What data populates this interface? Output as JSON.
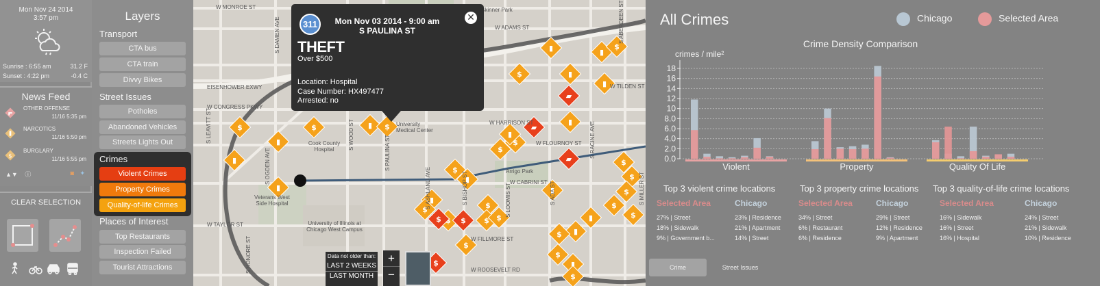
{
  "weather": {
    "date": "Mon Nov 24 2014",
    "time": "3:57 pm",
    "sunrise": "Sunrise : 6:55 am",
    "sunset": "Sunset : 4:22 pm",
    "temp_high": "31.2 F",
    "temp_low": "-0.4 C",
    "icon": "partly-cloudy-icon"
  },
  "news": {
    "title": "News Feed",
    "items": [
      {
        "type": "OTHER OFFENSE",
        "time": "11/16 5:35 pm",
        "color": "#e84c3d"
      },
      {
        "type": "NARCOTICS",
        "time": "11/16 5:50 pm",
        "color": "#f39c12"
      },
      {
        "type": "BURGLARY",
        "time": "11/16 5:55 pm",
        "color": "#f39c12"
      }
    ]
  },
  "clear_selection": "CLEAR SELECTION",
  "layers": {
    "title": "Layers",
    "transport": {
      "title": "Transport",
      "items": [
        "CTA bus",
        "CTA train",
        "Divvy Bikes"
      ]
    },
    "street": {
      "title": "Street Issues",
      "items": [
        "Potholes",
        "Abandoned Vehicles",
        "Streets Lights Out"
      ]
    },
    "crimes": {
      "title": "Crimes",
      "items": [
        {
          "label": "Violent Crimes",
          "color": "#e53e12"
        },
        {
          "label": "Property Crimes",
          "color": "#f07a0c"
        },
        {
          "label": "Quality-of-life Crimes",
          "color": "#f4a20f"
        }
      ]
    },
    "places": {
      "title": "Places of Interest",
      "items": [
        "Top Restaurants",
        "Inspection Failed Restaurants",
        "Tourist Attractions"
      ]
    }
  },
  "map": {
    "streets_h": [
      "W MONROE ST",
      "W ADAMS ST",
      "EISENHOWER EXWY",
      "W CONGRESS PKWY",
      "W HARRISON ST",
      "W FLOURNOY ST",
      "W CABRINI ST",
      "W TAYLOR ST",
      "W FILLMORE ST",
      "W ROOSEVELT RD",
      "W TILDEN ST",
      "Skinner Park",
      "Arrigo Park"
    ],
    "streets_v": [
      "S DAMEN AVE",
      "S LEAVITT ST",
      "S WOOD ST",
      "S PAULINA ST",
      "S ASHLAND AVE",
      "S LOOMIS ST",
      "S ADA ST",
      "S RACINE AVE",
      "S MILLER ST",
      "S ABERDEEN ST",
      "S HONORE ST",
      "S OGDEN AVE",
      "S BISHOP ST"
    ],
    "places": [
      "Cook County Hospital",
      "Veterans West Side Hospital",
      "University of Illinois at Chicago West Campus",
      "University Medical Center"
    ],
    "popup": {
      "badge": "311",
      "date": "Mon Nov 03 2014 - 9:00 am",
      "address": "S PAULINA ST",
      "type": "THEFT",
      "subtype": "Over $500",
      "location": "Location: Hospital",
      "case": "Case Number: HX497477",
      "arrested": "Arrested: no",
      "close": "✕"
    },
    "filter": {
      "title": "Data not older than:",
      "options": [
        "LAST 2 WEEKS",
        "LAST MONTH"
      ]
    },
    "zoom_in": "+",
    "zoom_out": "−"
  },
  "stats": {
    "title": "All Crimes",
    "legend": [
      {
        "label": "Chicago",
        "color": "#b8c7d3"
      },
      {
        "label": "Selected Area",
        "color": "#e59a9a"
      }
    ],
    "chart_title": "Crime Density Comparison",
    "ylabel": "crimes / mile²"
  },
  "chart_data": {
    "type": "bar",
    "title": "Crime Density Comparison",
    "ylabel": "crimes / mile²",
    "ylim": [
      0,
      19
    ],
    "yticks": [
      "0.0",
      "2.0",
      "4.0",
      "6.0",
      "8.0",
      "10",
      "12",
      "14",
      "16",
      "18"
    ],
    "groups": [
      {
        "name": "Violent",
        "baseline_color": "#e8a3a3",
        "chicago": [
          11.8,
          1.0,
          0.5,
          0.3,
          0.6,
          4.1,
          0.5
        ],
        "selected": [
          5.7,
          0.4,
          0.1,
          0.1,
          0.3,
          2.2,
          0.4
        ]
      },
      {
        "name": "Property",
        "baseline_color": "#f4c27a",
        "chicago": [
          3.5,
          10.0,
          2.3,
          2.5,
          2.8,
          18.5,
          0.3
        ],
        "selected": [
          1.9,
          8.1,
          2.0,
          1.9,
          2.0,
          16.4,
          0.2
        ]
      },
      {
        "name": "Quality Of Life",
        "baseline_color": "#f5cd6e",
        "chicago": [
          3.7,
          1.0,
          0.5,
          6.4,
          0.6,
          0.8,
          1.0
        ],
        "selected": [
          3.3,
          6.4,
          0.1,
          1.5,
          0.4,
          0.9,
          0.4
        ]
      }
    ]
  },
  "top3": [
    {
      "title": "Top 3 violent crime locations",
      "selected": [
        "27% | Street",
        "18% | Sidewalk",
        "9% | Government b..."
      ],
      "chicago": [
        "23% | Residence",
        "21% | Apartment",
        "14% | Street"
      ]
    },
    {
      "title": "Top 3 property crime locations",
      "selected": [
        "34% | Street",
        "6% | Restaurant",
        "6% | Residence"
      ],
      "chicago": [
        "29% | Street",
        "12% | Residence",
        "9% | Apartment"
      ]
    },
    {
      "title": "Top 3 quality-of-life crime locations",
      "selected": [
        "16% | Sidewalk",
        "16% | Street",
        "16% | Hospital"
      ],
      "chicago": [
        "24% | Street",
        "21% | Sidewalk",
        "10% | Residence"
      ]
    }
  ],
  "col_selected": "Selected Area",
  "col_chicago": "Chicago",
  "tabs": [
    "Crime",
    "Street Issues"
  ]
}
